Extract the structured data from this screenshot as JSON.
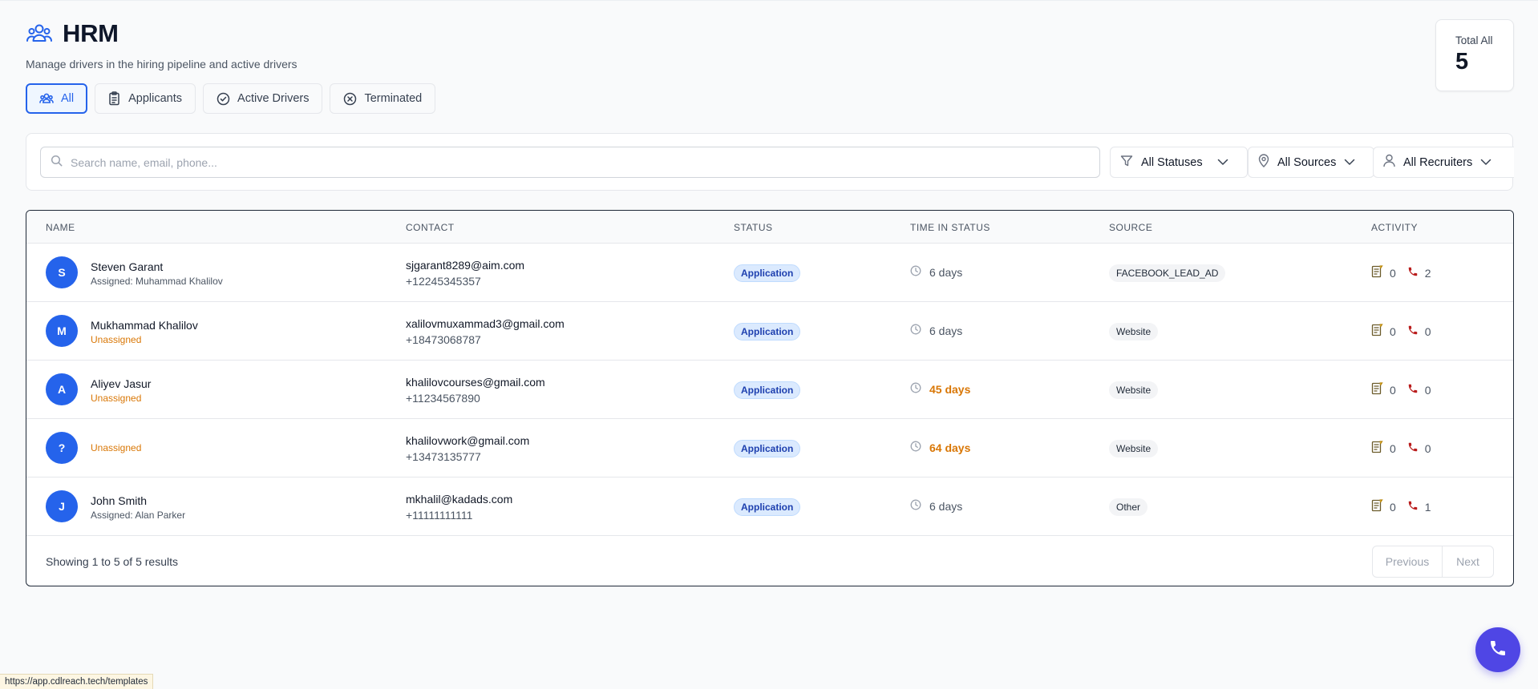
{
  "header": {
    "title": "HRM",
    "subtitle": "Manage drivers in the hiring pipeline and active drivers"
  },
  "tabs": [
    {
      "label": "All",
      "active": true,
      "icon": "users-icon"
    },
    {
      "label": "Applicants",
      "active": false,
      "icon": "clipboard-icon"
    },
    {
      "label": "Active Drivers",
      "active": false,
      "icon": "check-circle-icon"
    },
    {
      "label": "Terminated",
      "active": false,
      "icon": "x-circle-icon"
    }
  ],
  "total": {
    "label": "Total All",
    "value": "5"
  },
  "filters": {
    "search_placeholder": "Search name, email, phone...",
    "status": "All Statuses",
    "source": "All Sources",
    "recruiter": "All Recruiters"
  },
  "table": {
    "columns": [
      "NAME",
      "CONTACT",
      "STATUS",
      "TIME IN STATUS",
      "SOURCE",
      "ACTIVITY"
    ],
    "rows": [
      {
        "initial": "S",
        "name": "Steven Garant",
        "assigned": "Assigned: Muhammad Khalilov",
        "email": "sjgarant8289@aim.com",
        "phone": "+12245345357",
        "status": "Application",
        "time": "6 days",
        "source": "FACEBOOK_LEAD_AD",
        "notes": "0",
        "calls": "2"
      },
      {
        "initial": "M",
        "name": "Mukhammad Khalilov",
        "assigned": "Unassigned",
        "email": "xalilovmuxammad3@gmail.com",
        "phone": "+18473068787",
        "status": "Application",
        "time": "6 days",
        "source": "Website",
        "notes": "0",
        "calls": "0"
      },
      {
        "initial": "A",
        "name": "Aliyev Jasur",
        "assigned": "Unassigned",
        "email": "khalilovcourses@gmail.com",
        "phone": "+11234567890",
        "status": "Application",
        "time": "45 days",
        "source": "Website",
        "notes": "0",
        "calls": "0"
      },
      {
        "initial": "?",
        "name": "",
        "assigned": "Unassigned",
        "email": "khalilovwork@gmail.com",
        "phone": "+13473135777",
        "status": "Application",
        "time": "64 days",
        "source": "Website",
        "notes": "0",
        "calls": "0"
      },
      {
        "initial": "J",
        "name": "John Smith",
        "assigned": "Assigned: Alan Parker",
        "email": "mkhalil@kadads.com",
        "phone": "+11111111111",
        "status": "Application",
        "time": "6 days",
        "source": "Other",
        "notes": "0",
        "calls": "1"
      }
    ]
  },
  "pagination": {
    "summary": "Showing 1 to 5 of 5 results",
    "previous": "Previous",
    "next": "Next"
  },
  "status_bar_url": "https://app.cdlreach.tech/templates",
  "colors": {
    "accent": "#2563eb",
    "warning": "#d97706",
    "fab": "#4f46e5",
    "call": "#b91c1c"
  }
}
